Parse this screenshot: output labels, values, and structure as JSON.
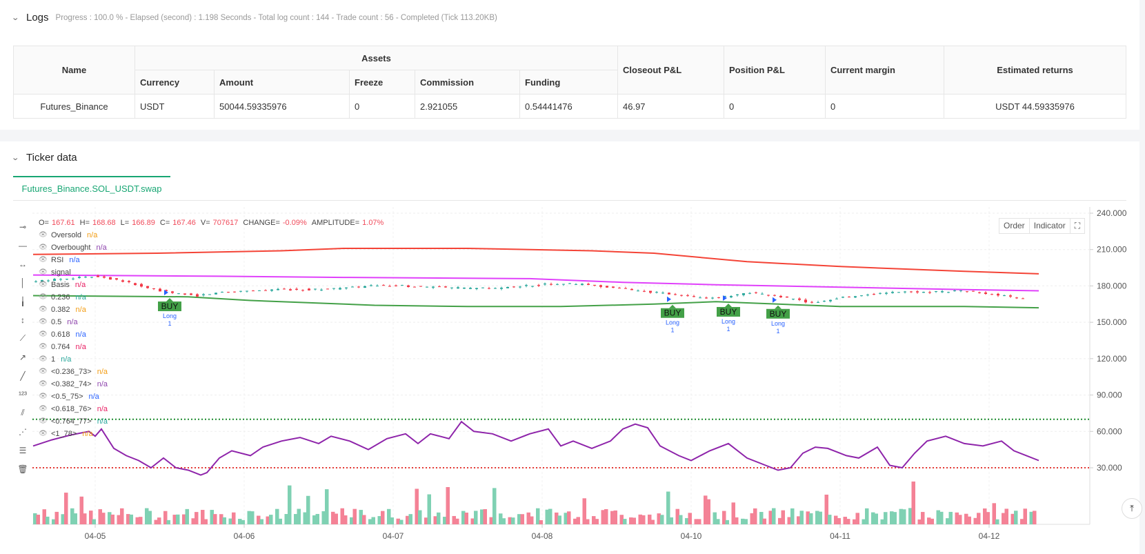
{
  "logs": {
    "title": "Logs",
    "summary": "Progress : 100.0 % - Elapsed (second) : 1.198  Seconds - Total log count : 144 - Trade count : 56 - Completed (Tick 113.20KB)"
  },
  "assets_table": {
    "group_header": "Assets",
    "headers": {
      "name": "Name",
      "currency": "Currency",
      "amount": "Amount",
      "freeze": "Freeze",
      "commission": "Commission",
      "funding": "Funding",
      "closeout": "Closeout P&L",
      "position": "Position P&L",
      "margin": "Current margin",
      "returns": "Estimated returns"
    },
    "row": {
      "name": "Futures_Binance",
      "currency": "USDT",
      "amount": "50044.59335976",
      "freeze": "0",
      "commission": "2.921055",
      "funding": "0.54441476",
      "closeout": "46.97",
      "position": "0",
      "margin": "0",
      "returns": "USDT 44.59335976"
    }
  },
  "ticker": {
    "title": "Ticker data",
    "tab": "Futures_Binance.SOL_USDT.swap"
  },
  "ohlc": {
    "o_label": "O=",
    "o": "167.61",
    "h_label": "H=",
    "h": "168.68",
    "l_label": "L=",
    "l": "166.89",
    "c_label": "C=",
    "c": "167.46",
    "v_label": "V=",
    "v": "707617",
    "change_label": "CHANGE=",
    "change": "-0.09%",
    "amp_label": "AMPLITUDE=",
    "amp": "1.07%"
  },
  "legend": [
    {
      "label": "Oversold",
      "value": "n/a",
      "color": "#f39c12"
    },
    {
      "label": "Overbought",
      "value": "n/a",
      "color": "#8e44ad"
    },
    {
      "label": "RSI",
      "value": "n/a",
      "color": "#2962ff"
    },
    {
      "label": "signal",
      "value": "",
      "color": "#333333"
    },
    {
      "label": "Basis",
      "value": "n/a",
      "color": "#e91e63"
    },
    {
      "label": "0.236",
      "value": "n/a",
      "color": "#26a69a"
    },
    {
      "label": "0.382",
      "value": "n/a",
      "color": "#f39c12"
    },
    {
      "label": "0.5",
      "value": "n/a",
      "color": "#8e44ad"
    },
    {
      "label": "0.618",
      "value": "n/a",
      "color": "#2962ff"
    },
    {
      "label": "0.764",
      "value": "n/a",
      "color": "#e91e63"
    },
    {
      "label": "1",
      "value": "n/a",
      "color": "#26a69a"
    },
    {
      "label": "<0.236_73>",
      "value": "n/a",
      "color": "#f39c12"
    },
    {
      "label": "<0.382_74>",
      "value": "n/a",
      "color": "#8e44ad"
    },
    {
      "label": "<0.5_75>",
      "value": "n/a",
      "color": "#2962ff"
    },
    {
      "label": "<0.618_76>",
      "value": "n/a",
      "color": "#e91e63"
    },
    {
      "label": "<0.764_77>",
      "value": "n/a",
      "color": "#26a69a"
    },
    {
      "label": "<1_78>",
      "value": "n/a",
      "color": "#f39c12"
    }
  ],
  "buttons": {
    "order": "Order",
    "indicator": "Indicator"
  },
  "chart_data": {
    "type": "candlestick",
    "y_ticks": [
      "240.000",
      "210.000",
      "180.000",
      "150.000",
      "120.000",
      "90.000",
      "60.000",
      "30.000"
    ],
    "y_tick_values": [
      240,
      210,
      180,
      150,
      120,
      90,
      60,
      30
    ],
    "ylim": [
      10,
      252
    ],
    "x_ticks": [
      "04-05",
      "04-06",
      "04-07",
      "04-08",
      "04-10",
      "04-11",
      "04-12"
    ],
    "x_tick_index": [
      20,
      68,
      116,
      164,
      212,
      260,
      308
    ],
    "n_bars": 324,
    "upper_band": [
      [
        0,
        206
      ],
      [
        40,
        207
      ],
      [
        80,
        209
      ],
      [
        100,
        211
      ],
      [
        140,
        211
      ],
      [
        180,
        209
      ],
      [
        200,
        207
      ],
      [
        230,
        200
      ],
      [
        260,
        196
      ],
      [
        300,
        192
      ],
      [
        324,
        190
      ]
    ],
    "mid_band": [
      [
        0,
        189
      ],
      [
        60,
        188
      ],
      [
        100,
        187
      ],
      [
        160,
        186
      ],
      [
        190,
        183
      ],
      [
        220,
        181
      ],
      [
        260,
        179
      ],
      [
        300,
        177
      ],
      [
        324,
        176
      ]
    ],
    "lower_band": [
      [
        0,
        172
      ],
      [
        50,
        171
      ],
      [
        70,
        168
      ],
      [
        110,
        164
      ],
      [
        140,
        163
      ],
      [
        170,
        163
      ],
      [
        200,
        165
      ],
      [
        220,
        167
      ],
      [
        240,
        165
      ],
      [
        260,
        163
      ],
      [
        300,
        163
      ],
      [
        324,
        162
      ]
    ],
    "price": [
      [
        0,
        183
      ],
      [
        10,
        186
      ],
      [
        22,
        188
      ],
      [
        30,
        184
      ],
      [
        38,
        178
      ],
      [
        46,
        174
      ],
      [
        54,
        172
      ],
      [
        62,
        175
      ],
      [
        70,
        176
      ],
      [
        80,
        177
      ],
      [
        90,
        177
      ],
      [
        100,
        178
      ],
      [
        110,
        180
      ],
      [
        120,
        180
      ],
      [
        130,
        179
      ],
      [
        140,
        178
      ],
      [
        150,
        178
      ],
      [
        160,
        180
      ],
      [
        170,
        182
      ],
      [
        180,
        181
      ],
      [
        190,
        178
      ],
      [
        200,
        175
      ],
      [
        210,
        172
      ],
      [
        216,
        170
      ],
      [
        224,
        171
      ],
      [
        232,
        174
      ],
      [
        240,
        172
      ],
      [
        246,
        169
      ],
      [
        252,
        166
      ],
      [
        260,
        170
      ],
      [
        270,
        173
      ],
      [
        280,
        175
      ],
      [
        290,
        175
      ],
      [
        300,
        176
      ],
      [
        310,
        173
      ],
      [
        318,
        170
      ],
      [
        324,
        168
      ]
    ],
    "rsi": [
      [
        0,
        48
      ],
      [
        6,
        53
      ],
      [
        12,
        57
      ],
      [
        18,
        60
      ],
      [
        20,
        56
      ],
      [
        22,
        62
      ],
      [
        26,
        46
      ],
      [
        30,
        40
      ],
      [
        34,
        36
      ],
      [
        38,
        30
      ],
      [
        42,
        38
      ],
      [
        46,
        30
      ],
      [
        50,
        28
      ],
      [
        54,
        24
      ],
      [
        56,
        26
      ],
      [
        60,
        38
      ],
      [
        64,
        44
      ],
      [
        70,
        40
      ],
      [
        74,
        47
      ],
      [
        80,
        52
      ],
      [
        86,
        55
      ],
      [
        92,
        50
      ],
      [
        96,
        56
      ],
      [
        102,
        52
      ],
      [
        108,
        45
      ],
      [
        114,
        54
      ],
      [
        120,
        58
      ],
      [
        124,
        50
      ],
      [
        128,
        58
      ],
      [
        134,
        54
      ],
      [
        138,
        68
      ],
      [
        142,
        60
      ],
      [
        148,
        58
      ],
      [
        154,
        52
      ],
      [
        160,
        58
      ],
      [
        166,
        62
      ],
      [
        170,
        48
      ],
      [
        174,
        52
      ],
      [
        180,
        46
      ],
      [
        186,
        52
      ],
      [
        190,
        62
      ],
      [
        194,
        66
      ],
      [
        198,
        63
      ],
      [
        202,
        48
      ],
      [
        208,
        40
      ],
      [
        212,
        36
      ],
      [
        218,
        44
      ],
      [
        224,
        50
      ],
      [
        230,
        38
      ],
      [
        236,
        32
      ],
      [
        240,
        28
      ],
      [
        244,
        30
      ],
      [
        248,
        42
      ],
      [
        252,
        47
      ],
      [
        256,
        46
      ],
      [
        262,
        40
      ],
      [
        266,
        38
      ],
      [
        272,
        47
      ],
      [
        276,
        32
      ],
      [
        280,
        30
      ],
      [
        284,
        42
      ],
      [
        288,
        52
      ],
      [
        294,
        56
      ],
      [
        300,
        50
      ],
      [
        306,
        48
      ],
      [
        312,
        52
      ],
      [
        316,
        44
      ],
      [
        320,
        40
      ],
      [
        324,
        36
      ]
    ],
    "rsi_overbought": 70,
    "rsi_oversold": 30,
    "buy_signals": [
      {
        "index": 44,
        "label": "BUY",
        "text": "Long",
        "count": "1"
      },
      {
        "index": 206,
        "label": "BUY",
        "text": "Long",
        "count": "1"
      },
      {
        "index": 224,
        "label": "BUY",
        "text": "Long",
        "count": "1"
      },
      {
        "index": 240,
        "label": "BUY",
        "text": "Long",
        "count": "1"
      }
    ],
    "colors": {
      "up": "#26a69a",
      "down": "#f23645",
      "upper": "#f44336",
      "mid": "#e040fb",
      "lower": "#43a047",
      "rsi": "#8e24aa",
      "overbought": "#1b8a2c",
      "oversold": "#e53935",
      "vol_up": "#7fd1b3",
      "vol_down": "#f48296"
    }
  }
}
